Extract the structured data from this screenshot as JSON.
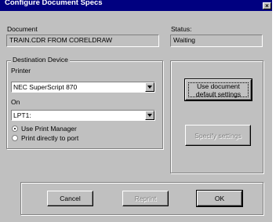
{
  "title": "Configure Document Specs",
  "close_glyph": "×",
  "document": {
    "label": "Document",
    "value": "TRAIN.CDR FROM CORELDRAW"
  },
  "status": {
    "label": "Status:",
    "value": "Waiting"
  },
  "destination": {
    "title": "Destination Device",
    "printer_label": "Printer",
    "printer_value": "NEC SuperScript 870",
    "on_label": "On",
    "on_value": "LPT1:",
    "radio_print_manager": "Use Print Manager",
    "radio_direct": "Print directly to port",
    "selected_radio": "print_manager"
  },
  "buttons": {
    "use_default_line1": "Use document",
    "use_default_line2": "default settings",
    "specify": "Specify settings",
    "cancel": "Cancel",
    "reprint": "Reprint",
    "ok": "OK"
  }
}
